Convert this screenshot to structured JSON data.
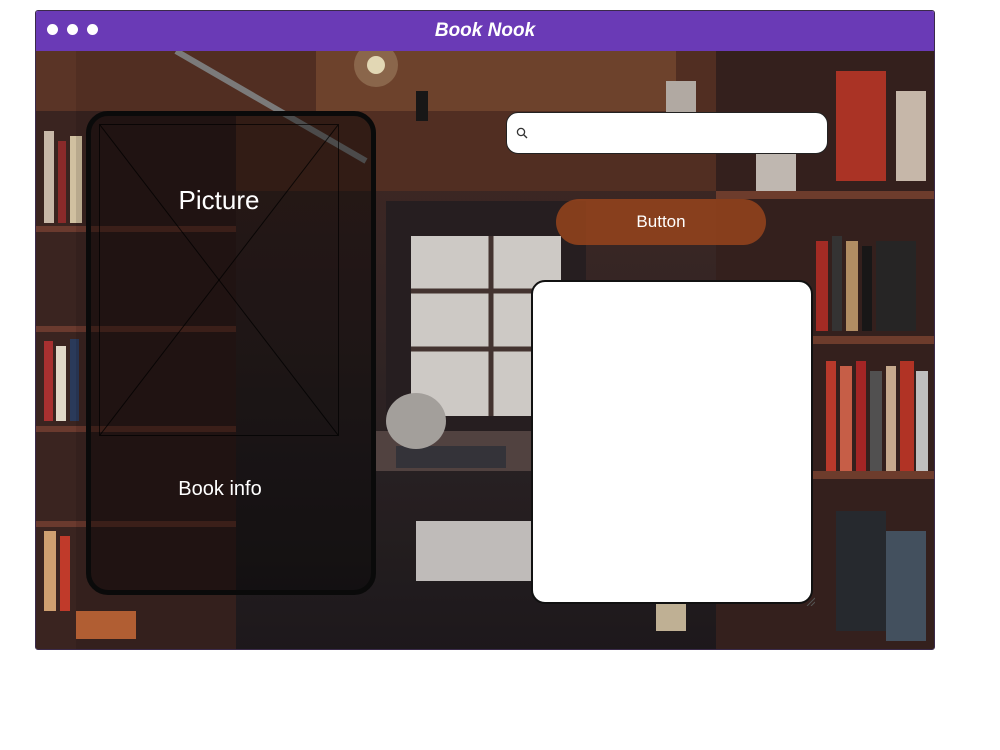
{
  "window": {
    "title": "Book Nook",
    "controls": [
      "dot",
      "dot",
      "dot"
    ]
  },
  "book_card": {
    "picture_label": "Picture",
    "info_label": "Book info"
  },
  "search": {
    "value": "",
    "placeholder": "",
    "icon": "search-icon"
  },
  "action_button": {
    "label": "Button"
  },
  "text_area": {
    "value": ""
  },
  "colors": {
    "titlebar": "#6a3ab6",
    "button": "#96441c",
    "background_scene": "#3b2a28"
  }
}
